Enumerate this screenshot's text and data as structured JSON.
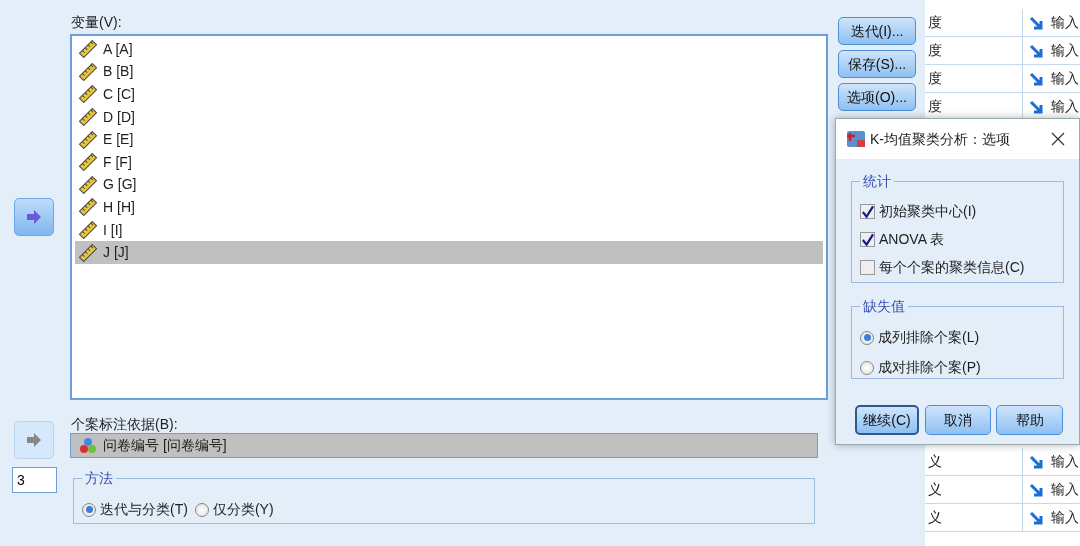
{
  "variables": {
    "label": "变量(V):",
    "items": [
      {
        "name": "A [A]",
        "selected": false
      },
      {
        "name": "B [B]",
        "selected": false
      },
      {
        "name": "C [C]",
        "selected": false
      },
      {
        "name": "D [D]",
        "selected": false
      },
      {
        "name": "E [E]",
        "selected": false
      },
      {
        "name": "F [F]",
        "selected": false
      },
      {
        "name": "G [G]",
        "selected": false
      },
      {
        "name": "H [H]",
        "selected": false
      },
      {
        "name": "I [I]",
        "selected": false
      },
      {
        "name": "J [J]",
        "selected": true
      }
    ]
  },
  "side_buttons": [
    "迭代(I)...",
    "保存(S)...",
    "选项(O)..."
  ],
  "move_buttons": [
    {
      "disabled": false
    },
    {
      "disabled": true
    }
  ],
  "cluster_count": {
    "value": "3"
  },
  "case_label": {
    "label": "个案标注依据(B):",
    "value": "问卷编号 [问卷编号]"
  },
  "method": {
    "title": "方法",
    "options": [
      {
        "label": "迭代与分类(T)",
        "selected": true
      },
      {
        "label": "仅分类(Y)",
        "selected": false
      }
    ]
  },
  "background_table": {
    "top_rows": [
      {
        "column_1": "度",
        "column_2": "输入"
      },
      {
        "column_1": "度",
        "column_2": "输入"
      },
      {
        "column_1": "度",
        "column_2": "输入"
      },
      {
        "column_1": "度",
        "column_2": "输入"
      }
    ],
    "bottom_rows": [
      {
        "column_1": "义",
        "column_2": "输入"
      },
      {
        "column_1": "义",
        "column_2": "输入"
      },
      {
        "column_1": "义",
        "column_2": "输入"
      }
    ]
  },
  "options_dialog": {
    "title": "K-均值聚类分析：选项",
    "statistics": {
      "title": "统计",
      "items": [
        {
          "label": "初始聚类中心(I)",
          "checked": true
        },
        {
          "label": "ANOVA 表",
          "checked": true
        },
        {
          "label": "每个个案的聚类信息(C)",
          "checked": false
        }
      ]
    },
    "missing": {
      "title": "缺失值",
      "options": [
        {
          "label": "成列排除个案(L)",
          "selected": true
        },
        {
          "label": "成对排除个案(P)",
          "selected": false
        }
      ]
    },
    "buttons": [
      {
        "label": "继续(C)",
        "default": true
      },
      {
        "label": "取消",
        "default": false
      },
      {
        "label": "帮助",
        "default": false
      }
    ]
  }
}
